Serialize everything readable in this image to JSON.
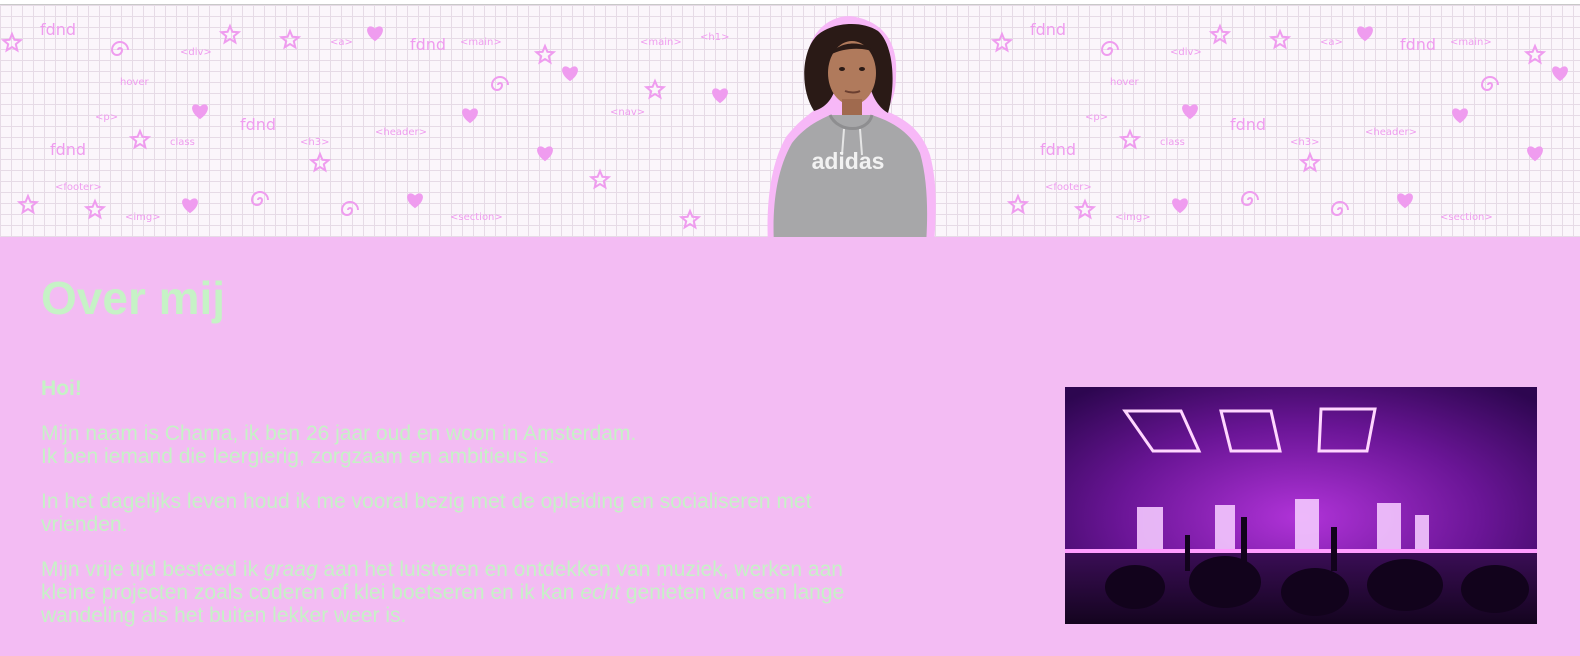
{
  "header": {
    "doodle_words": [
      "fdnd",
      "<div>",
      "<main>",
      "<p>",
      "<h1>",
      "class",
      "<header>",
      "<footer>",
      "<img>",
      "<nav>",
      "<section>",
      "<a>",
      "hover",
      "<h3>"
    ]
  },
  "about": {
    "title": "Over mij",
    "greeting": "Hoi!",
    "intro_line1": "Mijn naam is Chama, ik ben 26 jaar oud en woon in Amsterdam.",
    "intro_line2": "Ik ben iemand die leergierig, zorgzaam en ambitieus is.",
    "daily_life": "In het dagelijks leven houd ik me vooral bezig met de opleiding en socialiseren met vrienden.",
    "free_time": {
      "part1": "Mijn vrije tijd besteed ik ",
      "emph1": "graag",
      "part2": " aan het luisteren en ontdekken van muziek, werken aan kleine projecten zoals coderen of klei boetseren en ik kan ",
      "emph2": "echt",
      "part3": " genieten van een lange wandeling als het buiten lekker weer is."
    }
  },
  "colors": {
    "background": "#f3bcf3",
    "text": "#c6f2c6",
    "doodle": "#ef9cef"
  }
}
